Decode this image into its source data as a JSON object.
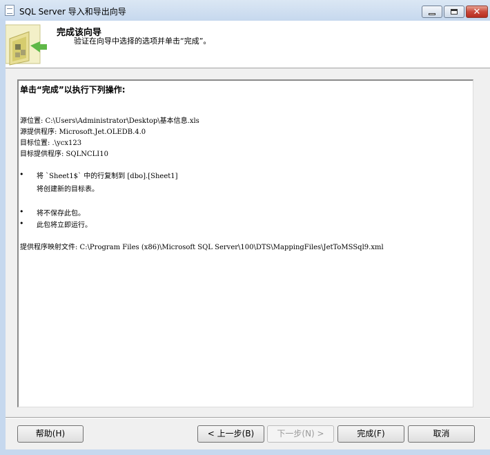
{
  "window": {
    "title": "SQL Server 导入和导出向导",
    "minimize_glyph": "",
    "close_glyph": "✕"
  },
  "header": {
    "title": "完成该向导",
    "subtitle": "验证在向导中选择的选项并单击“完成”。",
    "icon": "wizard-folder-icon"
  },
  "summary": {
    "heading": "单击“完成”以执行下列操作:",
    "source_location": "源位置: C:\\Users\\Administrator\\Desktop\\基本信息.xls",
    "source_provider": "源提供程序: Microsoft.Jet.OLEDB.4.0",
    "target_location": "目标位置: .\\ycx123",
    "target_provider": "目标提供程序: SQLNCLI10",
    "bullet_char": "•",
    "copy_action": "将 `Sheet1$` 中的行复制到 [dbo].[Sheet1]",
    "copy_note": "将创建新的目标表。",
    "not_save": "将不保存此包。",
    "run_now": "此包将立即运行。",
    "mapping_file": "提供程序映射文件: C:\\Program Files (x86)\\Microsoft SQL Server\\100\\DTS\\MappingFiles\\JetToMSSql9.xml"
  },
  "buttons": {
    "help": "帮助(H)",
    "back": "< 上一步(B)",
    "next": "下一步(N) >",
    "finish": "完成(F)",
    "cancel": "取消"
  }
}
